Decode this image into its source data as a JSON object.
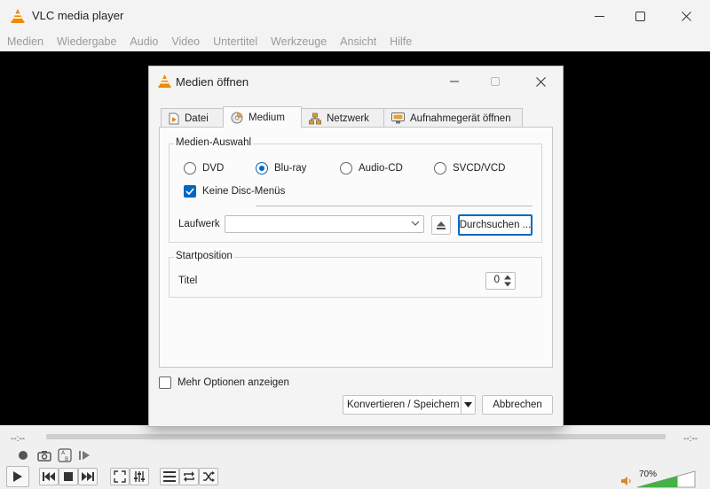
{
  "window": {
    "title": "VLC media player"
  },
  "menu": [
    "Medien",
    "Wiedergabe",
    "Audio",
    "Video",
    "Untertitel",
    "Werkzeuge",
    "Ansicht",
    "Hilfe"
  ],
  "player": {
    "time_elapsed": "--:--",
    "time_total": "--:--",
    "volume": "70%",
    "volume_level": 0.7
  },
  "dialog": {
    "title": "Medien öffnen",
    "tabs": [
      {
        "label": "Datei",
        "icon": "file-play-icon"
      },
      {
        "label": "Medium",
        "icon": "disc-icon",
        "active": true
      },
      {
        "label": "Netzwerk",
        "icon": "network-icon"
      },
      {
        "label": "Aufnahmegerät öffnen",
        "icon": "capture-device-icon"
      }
    ],
    "media_selection": {
      "title": "Medien-Auswahl",
      "options": [
        {
          "label": "DVD",
          "selected": false
        },
        {
          "label": "Blu-ray",
          "selected": true
        },
        {
          "label": "Audio-CD",
          "selected": false
        },
        {
          "label": "SVCD/VCD",
          "selected": false
        }
      ],
      "no_disc_menus": {
        "label": "Keine Disc-Menüs",
        "checked": true
      },
      "drive_label": "Laufwerk",
      "drive_value": "",
      "browse_label": "Durchsuchen ..."
    },
    "start_position": {
      "title": "Startposition",
      "title_label": "Titel",
      "title_value": "0"
    },
    "more_options": {
      "label": "Mehr Optionen anzeigen",
      "checked": false
    },
    "convert_label": "Konvertieren / Speichern",
    "cancel_label": "Abbrechen"
  }
}
